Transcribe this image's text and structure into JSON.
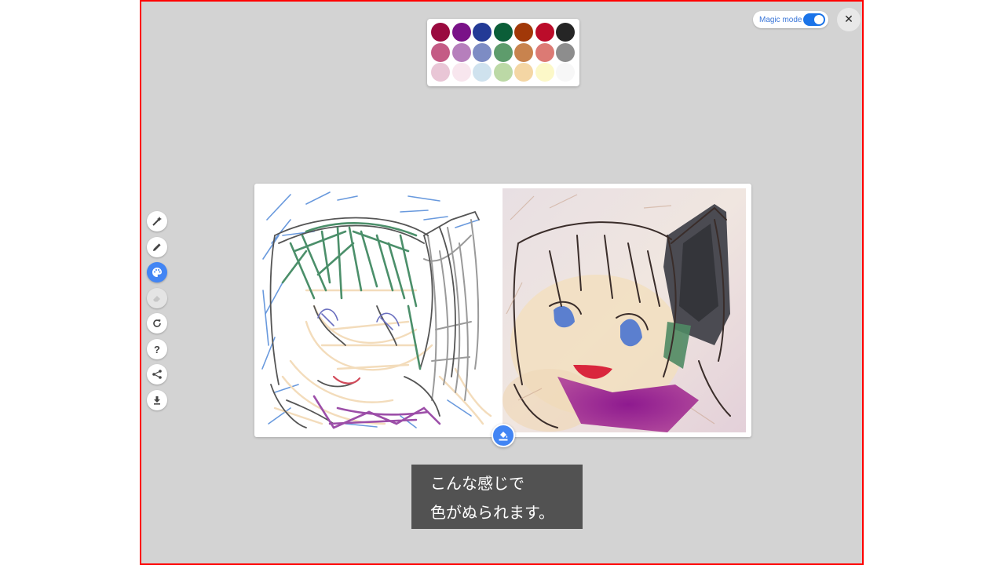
{
  "palette": {
    "rows": [
      [
        "#9a0a3f",
        "#7a1288",
        "#233a96",
        "#0b5e38",
        "#a13808",
        "#bb0c2a",
        "#252525"
      ],
      [
        "#c45b85",
        "#b67fbc",
        "#7d8cc4",
        "#5e9c6c",
        "#c8834e",
        "#dc7a74",
        "#8d8d8d"
      ],
      [
        "#e9c6d6",
        "#f8e6ee",
        "#cfe2ee",
        "#bcd9a6",
        "#f4d6a4",
        "#fcf8c8",
        "#f7f7f7"
      ]
    ]
  },
  "magic_mode": {
    "label": "Magic mode",
    "enabled": true,
    "accent": "#1a73e8"
  },
  "close": {
    "icon": "close-icon",
    "glyph": "✕"
  },
  "toolbar": {
    "tools": [
      {
        "name": "magic-wand-icon",
        "active": false,
        "disabled": false
      },
      {
        "name": "pencil-icon",
        "active": false,
        "disabled": false
      },
      {
        "name": "palette-icon",
        "active": true,
        "disabled": false
      },
      {
        "name": "eraser-icon",
        "active": false,
        "disabled": true
      },
      {
        "name": "refresh-icon",
        "active": false,
        "disabled": false
      },
      {
        "name": "help-icon",
        "active": false,
        "disabled": false
      },
      {
        "name": "share-icon",
        "active": false,
        "disabled": false
      },
      {
        "name": "download-icon",
        "active": false,
        "disabled": false
      }
    ],
    "help_glyph": "?"
  },
  "caption": {
    "line1": "こんな感じで",
    "line2": "色がぬられます。"
  },
  "colors": {
    "active": "#4285f4",
    "background": "#d3d3d3",
    "frame": "#ff0000",
    "caption_bg": "#525252"
  }
}
